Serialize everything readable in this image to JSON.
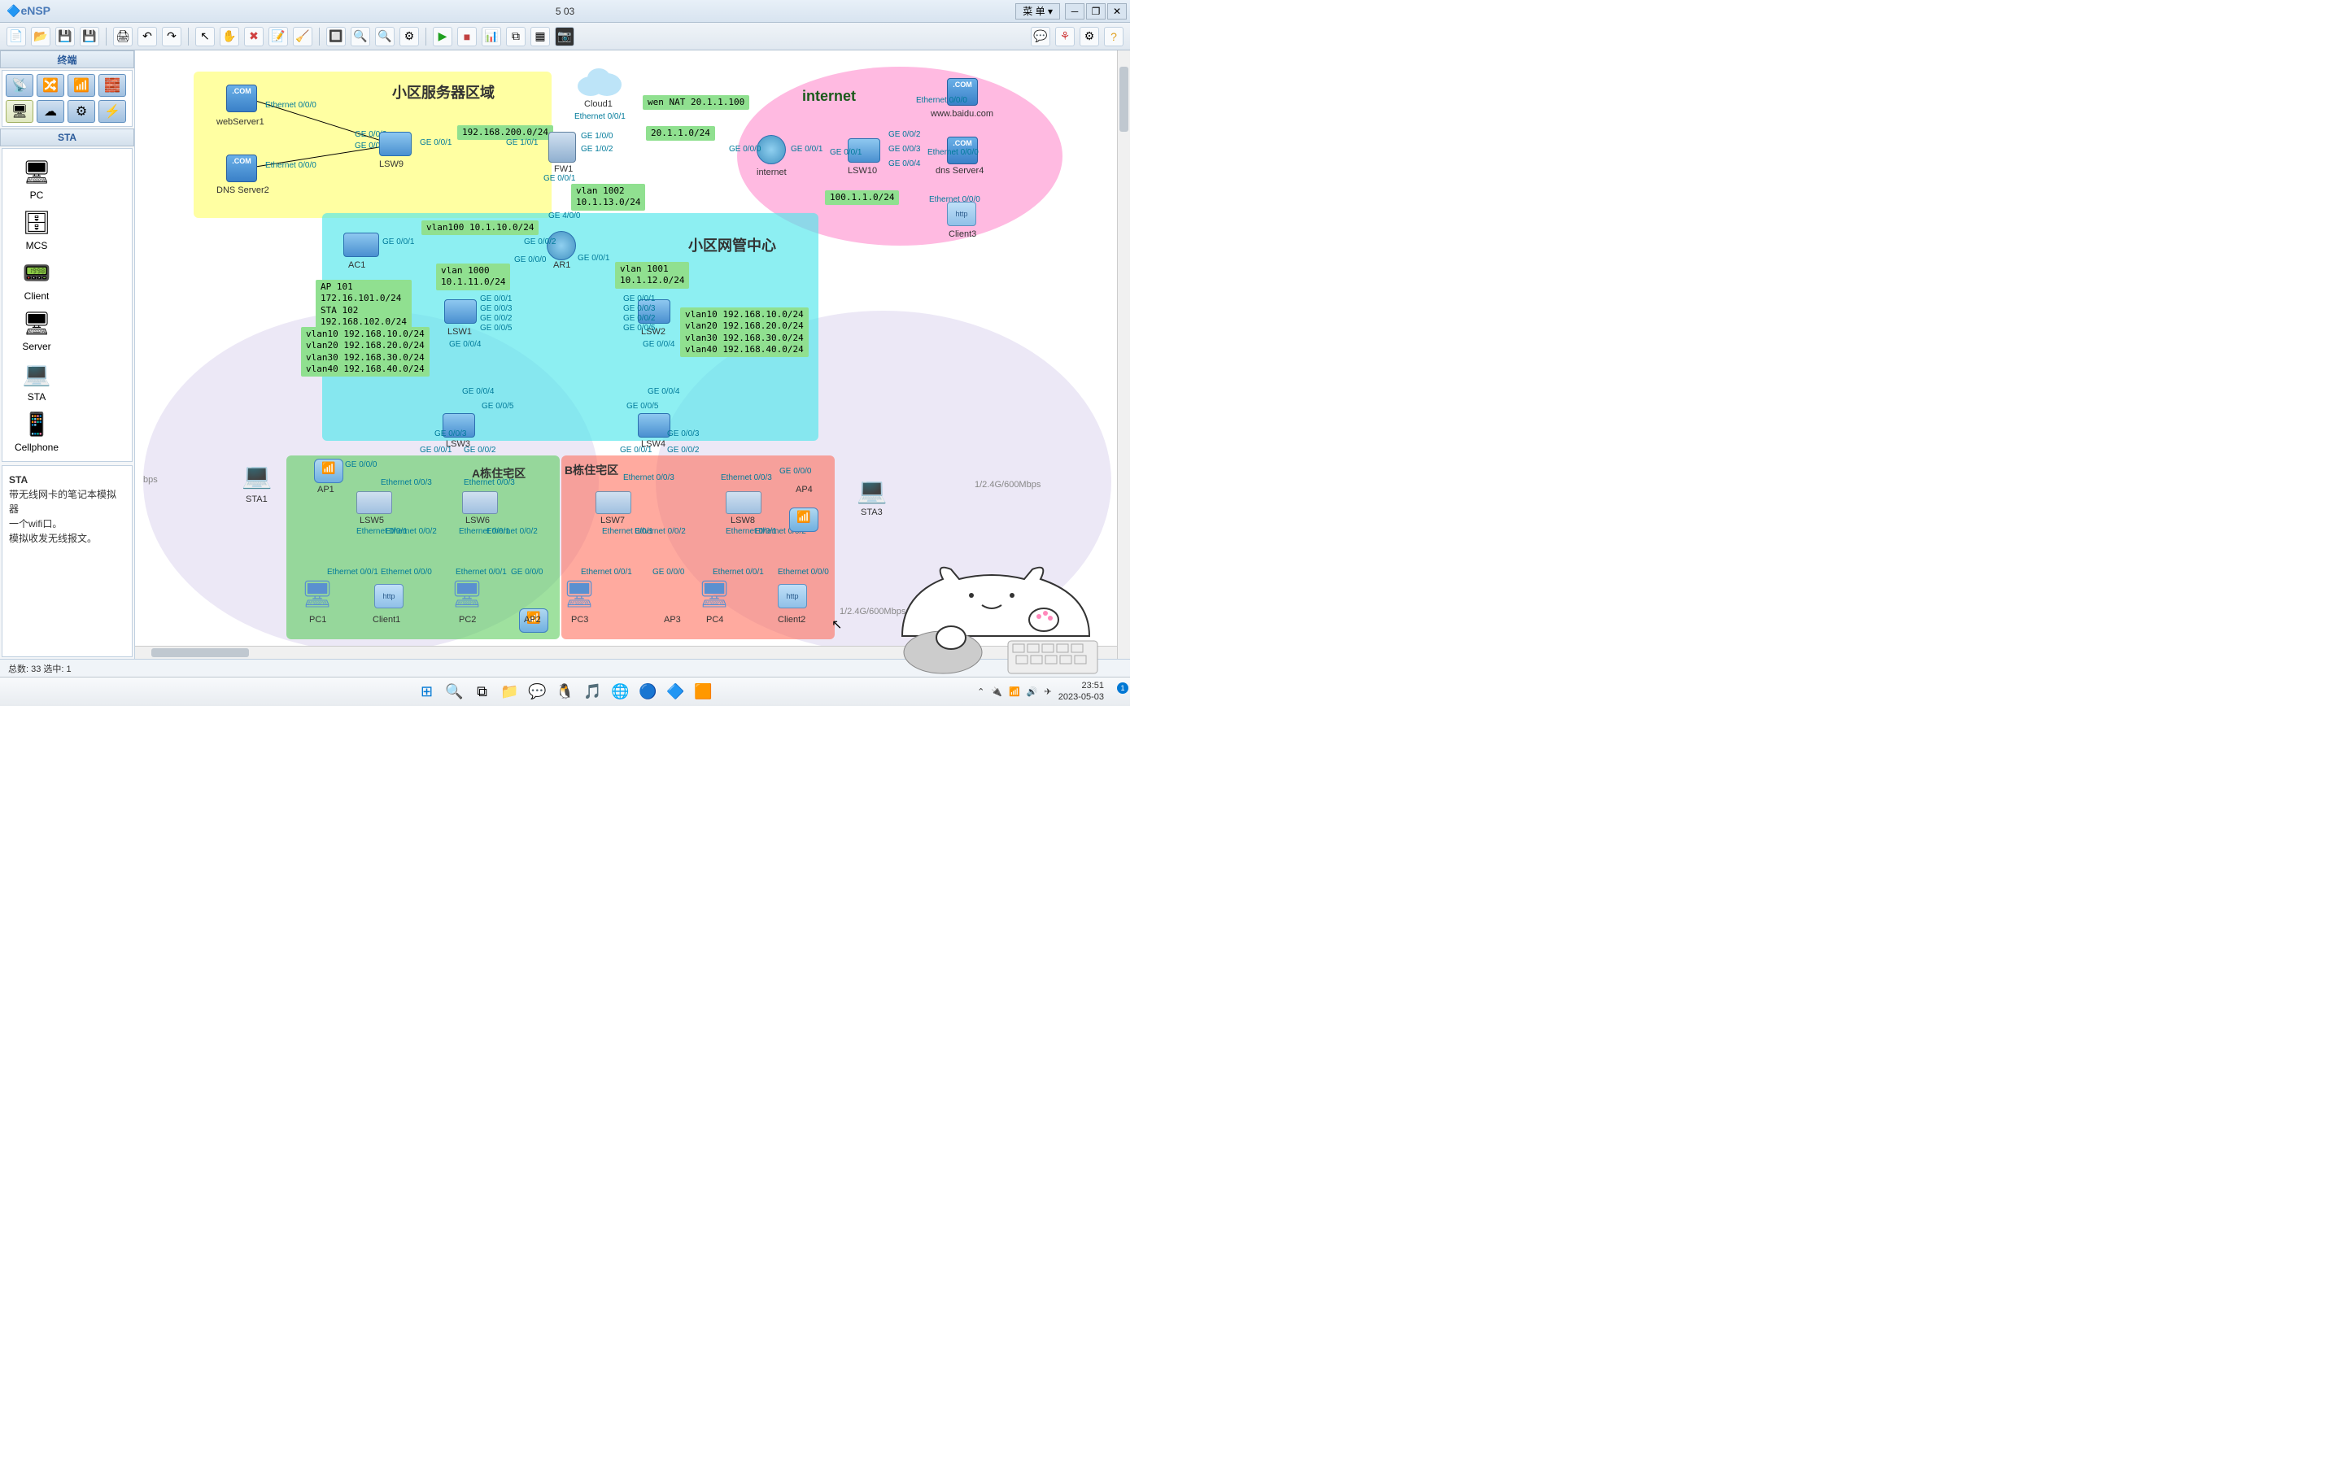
{
  "app": {
    "logo": "eNSP",
    "title": "5 03",
    "menu_label": "菜 单 ▾"
  },
  "win_controls": {
    "min": "─",
    "max": "❐",
    "close": "✕"
  },
  "toolbar": {
    "new": "📄",
    "open": "📂",
    "save": "💾",
    "saveall": "💾",
    "print": "🖨",
    "undo": "↶",
    "redo": "↷",
    "select": "↖",
    "hand": "✋",
    "delete": "✖",
    "edit": "📝",
    "broom": "🧹",
    "zoomin": "🔍",
    "zoomfit": "🔲",
    "zoomout": "🔍",
    "config": "⚙",
    "start": "▶",
    "stop": "■",
    "capture": "📊",
    "topo": "⧉",
    "palette": "▦",
    "screenshot": "📷",
    "chat": "💬",
    "huawei": "⚘",
    "settings": "⚙",
    "help": "?"
  },
  "left_panel": {
    "header1": "终端",
    "header2": "STA",
    "devices": [
      {
        "name": "PC",
        "icon": "🖥"
      },
      {
        "name": "MCS",
        "icon": "🗄"
      },
      {
        "name": "Client",
        "icon": "📟"
      },
      {
        "name": "Server",
        "icon": "🖥"
      },
      {
        "name": "STA",
        "icon": "💻"
      },
      {
        "name": "Cellphone",
        "icon": "📱"
      }
    ],
    "info": {
      "name": "STA",
      "desc": "带无线网卡的笔记本模拟器\n一个wifi口。\n模拟收发无线报文。"
    }
  },
  "zones": {
    "server_area": "小区服务器区域",
    "internet": "internet",
    "noc": "小区网管中心",
    "bldg_a": "A栋住宅区",
    "bldg_b": "B栋住宅区"
  },
  "netlabels": {
    "l1": "192.168.200.0/24",
    "l2": "wen NAT 20.1.1.100",
    "l3": "20.1.1.0/24",
    "l4": "100.1.1.0/24",
    "l5": "vlan 1002\n10.1.13.0/24",
    "l6": "vlan100 10.1.10.0/24",
    "l7": "vlan 1000\n10.1.11.0/24",
    "l8": "vlan 1001\n10.1.12.0/24",
    "l9": "AP 101\n172.16.101.0/24\nSTA 102\n192.168.102.0/24",
    "l10": "vlan10 192.168.10.0/24\nvlan20 192.168.20.0/24\nvlan30 192.168.30.0/24\nvlan40 192.168.40.0/24",
    "l11": "vlan10 192.168.10.0/24\nvlan20 192.168.20.0/24\nvlan30 192.168.30.0/24\nvlan40 192.168.40.0/24"
  },
  "ports": {
    "eth00": "Ethernet 0/0/0",
    "eth01": "Ethernet 0/0/1",
    "eth02": "Ethernet 0/0/2",
    "eth03": "Ethernet 0/0/3",
    "ge001": "GE 0/0/1",
    "ge002": "GE 0/0/2",
    "ge003": "GE 0/0/3",
    "ge004": "GE 0/0/4",
    "ge005": "GE 0/0/5",
    "ge000": "GE 0/0/0",
    "ge100": "GE 1/0/0",
    "ge101": "GE 1/0/1",
    "ge102": "GE 1/0/2",
    "ge400": "GE 4/0/0"
  },
  "devices": {
    "webserver": "webServer1",
    "dnsserver2": "DNS Server2",
    "lsw9": "LSW9",
    "cloud1": "Cloud1",
    "fw1": "FW1",
    "internet_r": "internet",
    "lsw10": "LSW10",
    "baidu": "www.baidu.com",
    "dnsserver4": "dns Server4",
    "client3": "Client3",
    "ar1": "AR1",
    "ac1": "AC1",
    "lsw1": "LSW1",
    "lsw2": "LSW2",
    "lsw3": "LSW3",
    "lsw4": "LSW4",
    "lsw5": "LSW5",
    "lsw6": "LSW6",
    "lsw7": "LSW7",
    "lsw8": "LSW8",
    "ap1": "AP1",
    "ap2": "AP2",
    "ap3": "AP3",
    "ap4": "AP4",
    "sta1": "STA1",
    "sta3": "STA3",
    "pc1": "PC1",
    "pc2": "PC2",
    "pc3": "PC3",
    "pc4": "PC4",
    "client1": "Client1",
    "client2": "Client2"
  },
  "wifi": {
    "label1": "bps",
    "label2": "1/2.4G/600Mbps",
    "label3": "1/2.4G/600Mbps"
  },
  "status_bar": {
    "text": "总数: 33 选中: 1"
  },
  "taskbar": {
    "time": "23:51",
    "date": "2023-05-03",
    "tray_icons": [
      "⌃",
      "🔌",
      "📶",
      "🔊",
      "✈"
    ]
  }
}
